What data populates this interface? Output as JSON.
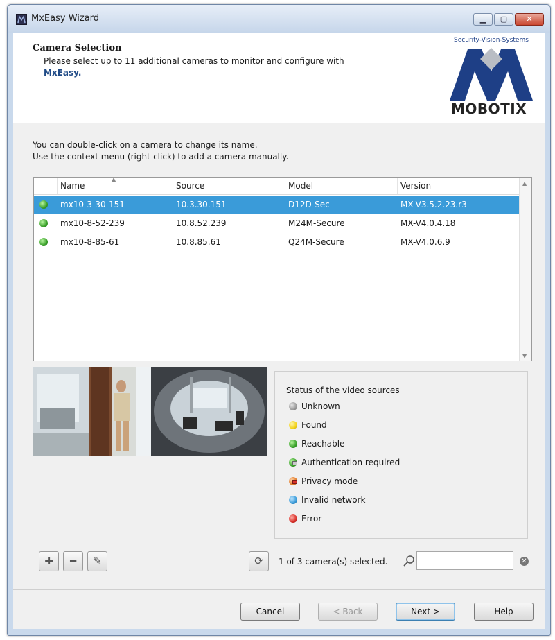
{
  "window": {
    "title": "MxEasy Wizard"
  },
  "header": {
    "title": "Camera Selection",
    "subtitle": "Please select up to 11 additional cameras to monitor and configure with",
    "subtitle_app": "MxEasy."
  },
  "logo": {
    "tagline": "Security-Vision-Systems",
    "wordmark": "MOBOTIX"
  },
  "instructions": {
    "line1": "You can double-click on a camera to change its name.",
    "line2": "Use the context menu (right-click) to add a camera manually."
  },
  "table": {
    "columns": [
      "Name",
      "Source",
      "Model",
      "Version"
    ],
    "rows": [
      {
        "name": "mx10-3-30-151",
        "source": "10.3.30.151",
        "model": "D12D-Sec",
        "version": "MX-V3.5.2.23.r3",
        "selected": true,
        "status": "reachable"
      },
      {
        "name": "mx10-8-52-239",
        "source": "10.8.52.239",
        "model": "M24M-Secure",
        "version": "MX-V4.0.4.18",
        "selected": false,
        "status": "reachable"
      },
      {
        "name": "mx10-8-85-61",
        "source": "10.8.85.61",
        "model": "Q24M-Secure",
        "version": "MX-V4.0.6.9",
        "selected": false,
        "status": "reachable"
      }
    ]
  },
  "legend": {
    "title": "Status of the video sources",
    "items": [
      {
        "label": "Unknown",
        "color": "#9a9a9a"
      },
      {
        "label": "Found",
        "color": "#f2d21a"
      },
      {
        "label": "Reachable",
        "color": "#3aa12a"
      },
      {
        "label": "Authentication required",
        "color": "#3aa12a"
      },
      {
        "label": "Privacy mode",
        "color": "#e07a2a"
      },
      {
        "label": "Invalid network",
        "color": "#3a9bd9"
      },
      {
        "label": "Error",
        "color": "#d8302a"
      }
    ]
  },
  "toolbar": {
    "add_icon": "plus-icon",
    "remove_icon": "minus-icon",
    "edit_icon": "pencil-icon",
    "scan_icon": "network-scan-icon"
  },
  "selection": {
    "text": "1 of 3 camera(s) selected.",
    "search_placeholder": ""
  },
  "buttons": {
    "cancel": "Cancel",
    "back": "< Back",
    "next": "Next >",
    "help": "Help"
  },
  "colors": {
    "selection": "#3a9bd9",
    "brand": "#1e3f86"
  }
}
